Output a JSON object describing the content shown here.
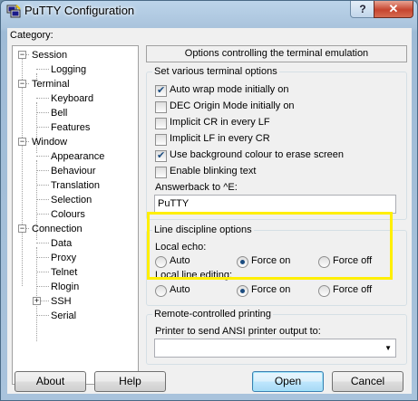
{
  "window": {
    "title": "PuTTY Configuration",
    "help_glyph": "?",
    "close_glyph": "✕"
  },
  "category_label": "Category:",
  "tree": [
    {
      "label": "Session"
    },
    {
      "label": "Logging"
    },
    {
      "label": "Terminal"
    },
    {
      "label": "Keyboard"
    },
    {
      "label": "Bell"
    },
    {
      "label": "Features"
    },
    {
      "label": "Window"
    },
    {
      "label": "Appearance"
    },
    {
      "label": "Behaviour"
    },
    {
      "label": "Translation"
    },
    {
      "label": "Selection"
    },
    {
      "label": "Colours"
    },
    {
      "label": "Connection"
    },
    {
      "label": "Data"
    },
    {
      "label": "Proxy"
    },
    {
      "label": "Telnet"
    },
    {
      "label": "Rlogin"
    },
    {
      "label": "SSH"
    },
    {
      "label": "Serial"
    }
  ],
  "panel_title": "Options controlling the terminal emulation",
  "terminal_options": {
    "title": "Set various terminal options",
    "options": [
      {
        "label": "Auto wrap mode initially on",
        "checked": true
      },
      {
        "label": "DEC Origin Mode initially on",
        "checked": false
      },
      {
        "label": "Implicit CR in every LF",
        "checked": false
      },
      {
        "label": "Implicit LF in every CR",
        "checked": false
      },
      {
        "label": "Use background colour to erase screen",
        "checked": true
      },
      {
        "label": "Enable blinking text",
        "checked": false
      }
    ],
    "answerback_label": "Answerback to ^E:",
    "answerback_value": "PuTTY"
  },
  "line_discipline": {
    "title": "Line discipline options",
    "local_echo": {
      "label": "Local echo:",
      "options": [
        "Auto",
        "Force on",
        "Force off"
      ],
      "selected": "Force on"
    },
    "local_line_editing": {
      "label": "Local line editing:",
      "options": [
        "Auto",
        "Force on",
        "Force off"
      ],
      "selected": "Force on"
    }
  },
  "remote_printing": {
    "title": "Remote-controlled printing",
    "printer_label": "Printer to send ANSI printer output to:",
    "printer_value": ""
  },
  "buttons": {
    "about": "About",
    "help": "Help",
    "open": "Open",
    "cancel": "Cancel"
  },
  "colors": {
    "highlight": "#ffef00"
  }
}
